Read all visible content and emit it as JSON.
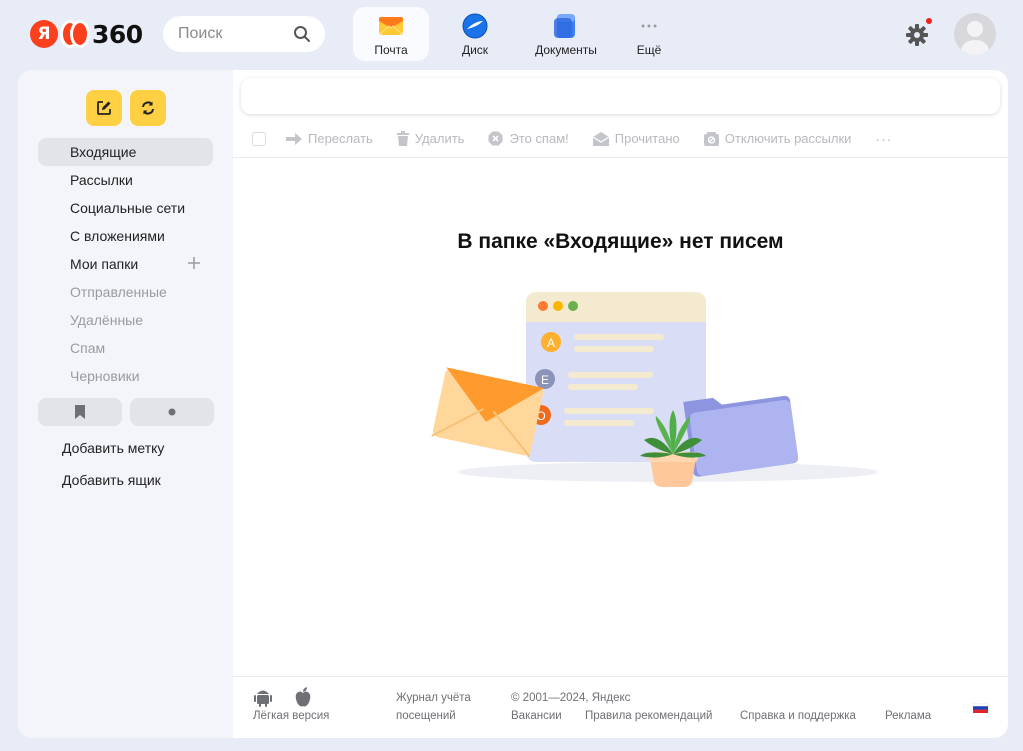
{
  "header": {
    "logo_letter": "Я",
    "logo_number": "360",
    "search_placeholder": "Поиск",
    "apps": [
      {
        "label": "Почта",
        "icon": "mail-icon"
      },
      {
        "label": "Диск",
        "icon": "disk-icon"
      },
      {
        "label": "Документы",
        "icon": "documents-icon"
      },
      {
        "label": "Ещё",
        "icon": "more-icon"
      }
    ],
    "colors": {
      "brand": "#fc3f1d",
      "notification": "#f2201d",
      "background": "#e8ecf7"
    }
  },
  "sidebar": {
    "folders": [
      {
        "label": "Входящие",
        "active": true
      },
      {
        "label": "Рассылки"
      },
      {
        "label": "Социальные сети"
      },
      {
        "label": "С вложениями"
      },
      {
        "label": "Мои папки",
        "has_add": true
      },
      {
        "label": "Отправленные",
        "dim": true
      },
      {
        "label": "Удалённые",
        "dim": true
      },
      {
        "label": "Спам",
        "dim": true
      },
      {
        "label": "Черновики",
        "dim": true
      }
    ],
    "add_label": "Добавить метку",
    "add_mailbox": "Добавить ящик",
    "accent_color": "#ffd043"
  },
  "toolbar": {
    "forward": "Переслать",
    "delete": "Удалить",
    "spam": "Это спам!",
    "read": "Прочитано",
    "unsubscribe": "Отключить рассылки",
    "more": "···"
  },
  "main": {
    "empty_title": "В папке «Входящие» нет писем",
    "illustration_letters": [
      "А",
      "Е",
      "О"
    ]
  },
  "footer": {
    "light_version": "Лёгкая версия",
    "journal_line1": "Журнал учёта",
    "journal_line2": "посещений",
    "copyright": "© 2001—2024, Яндекс",
    "links": [
      "Вакансии",
      "Правила рекомендаций",
      "Справка и поддержка",
      "Реклама"
    ]
  }
}
